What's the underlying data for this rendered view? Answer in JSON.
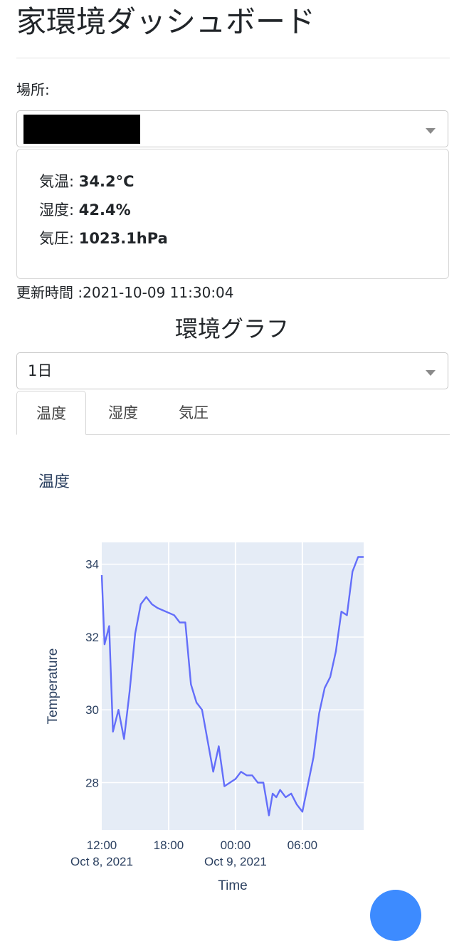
{
  "header": {
    "title": "家環境ダッシュボード"
  },
  "location": {
    "label": "場所:",
    "selected_value": ""
  },
  "readings": {
    "temperature_label": "気温:",
    "temperature_value": "34.2°C",
    "humidity_label": "湿度:",
    "humidity_value": "42.4%",
    "pressure_label": "気圧:",
    "pressure_value": "1023.1hPa"
  },
  "updated": {
    "text": "更新時間 :2021-10-09 11:30:04"
  },
  "graph": {
    "title": "環境グラフ",
    "range_value": "1日"
  },
  "tabs": [
    {
      "label": "温度",
      "active": true
    },
    {
      "label": "湿度",
      "active": false
    },
    {
      "label": "気圧",
      "active": false
    }
  ],
  "colors": {
    "line": "#636efa",
    "plot_bg": "#e5ecf6",
    "axis_text": "#2a3f5f",
    "fab": "#3d8bff"
  },
  "chart_data": {
    "type": "line",
    "title": "温度",
    "xlabel": "Time",
    "ylabel": "Temperature",
    "xlim": [
      "2021-10-08 12:00",
      "2021-10-09 11:30"
    ],
    "ylim": [
      26.7,
      34.6
    ],
    "x_ticks": [
      {
        "label": "12:00",
        "sub": "Oct 8, 2021",
        "value": "2021-10-08 12:00"
      },
      {
        "label": "18:00",
        "sub": "",
        "value": "2021-10-08 18:00"
      },
      {
        "label": "00:00",
        "sub": "Oct 9, 2021",
        "value": "2021-10-09 00:00"
      },
      {
        "label": "06:00",
        "sub": "",
        "value": "2021-10-09 06:00"
      }
    ],
    "y_ticks": [
      28,
      30,
      32,
      34
    ],
    "grid": true,
    "series": [
      {
        "x": [
          "2021-10-08 12:00",
          "2021-10-08 12:15",
          "2021-10-08 12:40",
          "2021-10-08 13:00",
          "2021-10-08 13:30",
          "2021-10-08 14:00",
          "2021-10-08 14:30",
          "2021-10-08 15:00",
          "2021-10-08 15:30",
          "2021-10-08 16:00",
          "2021-10-08 16:30",
          "2021-10-08 17:00",
          "2021-10-08 18:30",
          "2021-10-08 19:00",
          "2021-10-08 19:30",
          "2021-10-08 20:00",
          "2021-10-08 20:30",
          "2021-10-08 21:00",
          "2021-10-08 22:00",
          "2021-10-08 22:30",
          "2021-10-08 23:00",
          "2021-10-09 00:00",
          "2021-10-09 00:30",
          "2021-10-09 01:00",
          "2021-10-09 01:30",
          "2021-10-09 02:00",
          "2021-10-09 02:30",
          "2021-10-09 03:00",
          "2021-10-09 03:20",
          "2021-10-09 03:40",
          "2021-10-09 04:00",
          "2021-10-09 04:30",
          "2021-10-09 05:00",
          "2021-10-09 05:30",
          "2021-10-09 06:00",
          "2021-10-09 07:00",
          "2021-10-09 07:30",
          "2021-10-09 08:00",
          "2021-10-09 08:30",
          "2021-10-09 09:00",
          "2021-10-09 09:30",
          "2021-10-09 10:00",
          "2021-10-09 10:30",
          "2021-10-09 11:00",
          "2021-10-09 11:30"
        ],
        "y": [
          33.7,
          31.8,
          32.3,
          29.4,
          30.0,
          29.2,
          30.5,
          32.1,
          32.9,
          33.1,
          32.9,
          32.8,
          32.6,
          32.4,
          32.4,
          30.7,
          30.2,
          30.0,
          28.3,
          29.0,
          27.9,
          28.1,
          28.3,
          28.2,
          28.2,
          28.0,
          28.0,
          27.1,
          27.7,
          27.6,
          27.8,
          27.6,
          27.7,
          27.4,
          27.2,
          28.7,
          29.9,
          30.6,
          30.9,
          31.6,
          32.7,
          32.6,
          33.8,
          34.2,
          34.2
        ]
      }
    ]
  }
}
